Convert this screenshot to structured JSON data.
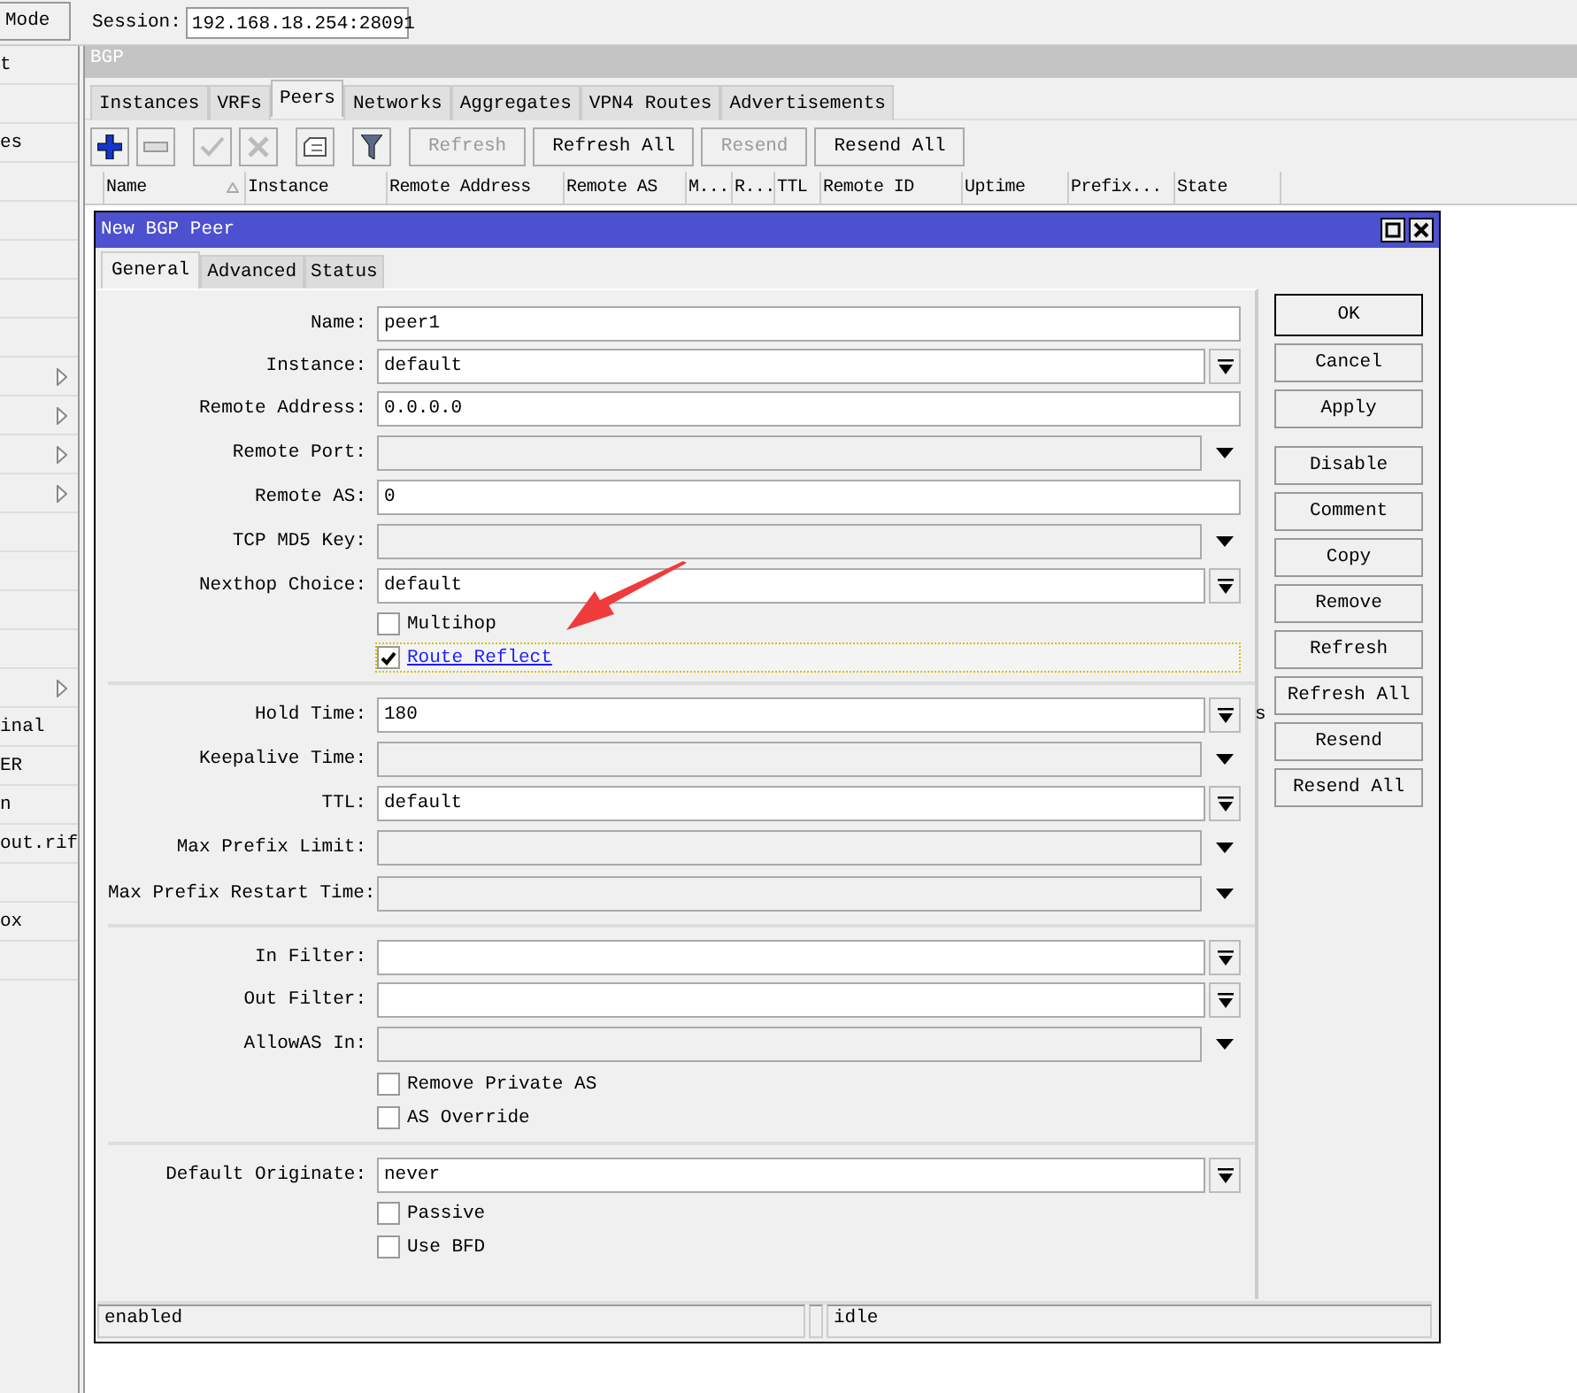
{
  "top_bar": {
    "mode_button": "Mode",
    "session_label": "Session:",
    "session_value": "192.168.18.254:28091"
  },
  "sidebar": {
    "items": [
      {
        "label": "t",
        "submenu": false
      },
      {
        "submenu": false
      },
      {
        "label": "es",
        "submenu": false
      },
      {
        "submenu": false
      },
      {
        "submenu": false
      },
      {
        "submenu": false
      },
      {
        "submenu": false
      },
      {
        "submenu": false
      },
      {
        "submenu": true
      },
      {
        "submenu": true
      },
      {
        "submenu": true
      },
      {
        "submenu": true
      },
      {
        "submenu": false
      },
      {
        "submenu": false
      },
      {
        "submenu": false
      },
      {
        "submenu": false
      },
      {
        "submenu": true
      },
      {
        "label": "inal",
        "submenu": false
      },
      {
        "label": "ER",
        "submenu": false
      },
      {
        "label": "n",
        "submenu": false
      },
      {
        "label": "out.rif",
        "submenu": false
      },
      {
        "submenu": false
      },
      {
        "label": "ox",
        "submenu": false
      },
      {
        "submenu": false
      }
    ]
  },
  "bgp_window": {
    "title": "BGP",
    "tabs": [
      {
        "label": "Instances",
        "selected": false
      },
      {
        "label": "VRFs",
        "selected": false
      },
      {
        "label": "Peers",
        "selected": true
      },
      {
        "label": "Networks",
        "selected": false
      },
      {
        "label": "Aggregates",
        "selected": false
      },
      {
        "label": "VPN4 Routes",
        "selected": false
      },
      {
        "label": "Advertisements",
        "selected": false
      }
    ],
    "toolbar": {
      "icon_buttons": [
        {
          "disabled": false
        },
        {
          "disabled": false
        },
        {
          "disabled": true
        },
        {
          "disabled": true
        },
        {
          "disabled": false
        },
        {
          "disabled": false
        }
      ],
      "text_buttons": [
        {
          "label": "Refresh",
          "disabled": true
        },
        {
          "label": "Refresh All",
          "disabled": false
        },
        {
          "label": "Resend",
          "disabled": true
        },
        {
          "label": "Resend All",
          "disabled": false
        }
      ]
    },
    "table": {
      "columns": [
        {
          "label": "Name",
          "sorted": true
        },
        {
          "label": "Instance",
          "sorted": false
        },
        {
          "label": "Remote Address",
          "sorted": false
        },
        {
          "label": "Remote AS",
          "sorted": false
        },
        {
          "label": "M...",
          "sorted": false
        },
        {
          "label": "R...",
          "sorted": false
        },
        {
          "label": "TTL",
          "sorted": false
        },
        {
          "label": "Remote ID",
          "sorted": false
        },
        {
          "label": "Uptime",
          "sorted": false
        },
        {
          "label": "Prefix...",
          "sorted": false
        },
        {
          "label": "State",
          "sorted": false
        }
      ]
    }
  },
  "dialog": {
    "title": "New BGP Peer",
    "tabs": [
      {
        "label": "General",
        "selected": true
      },
      {
        "label": "Advanced",
        "selected": false
      },
      {
        "label": "Status",
        "selected": false
      }
    ],
    "groups": [
      [
        {
          "kind": "text",
          "label": "Name:",
          "value": "peer1"
        },
        {
          "kind": "combo",
          "label": "Instance:",
          "value": "default"
        },
        {
          "kind": "text",
          "label": "Remote Address:",
          "value": "0.0.0.0"
        },
        {
          "kind": "select",
          "label": "Remote Port:"
        },
        {
          "kind": "text",
          "label": "Remote AS:",
          "value": "0"
        },
        {
          "kind": "select",
          "label": "TCP MD5 Key:"
        },
        {
          "kind": "combo",
          "label": "Nexthop Choice:",
          "value": "default"
        },
        {
          "kind": "checkbox",
          "label": "Multihop",
          "checked": false,
          "focused": false
        },
        {
          "kind": "checkbox",
          "label": "Route Reflect",
          "checked": true,
          "focused": true
        }
      ],
      [
        {
          "kind": "combo",
          "label": "Hold Time:",
          "value": "180",
          "unit": "s"
        },
        {
          "kind": "select",
          "label": "Keepalive Time:"
        },
        {
          "kind": "combo",
          "label": "TTL:",
          "value": "default"
        },
        {
          "kind": "select",
          "label": "Max Prefix Limit:"
        },
        {
          "kind": "select",
          "label": "Max Prefix Restart Time:"
        }
      ],
      [
        {
          "kind": "combo",
          "label": "In Filter:"
        },
        {
          "kind": "combo",
          "label": "Out Filter:"
        },
        {
          "kind": "select",
          "label": "AllowAS In:"
        },
        {
          "kind": "checkbox",
          "label": "Remove Private AS",
          "checked": false,
          "focused": false
        },
        {
          "kind": "checkbox",
          "label": "AS Override",
          "checked": false,
          "focused": false
        }
      ],
      [
        {
          "kind": "combo",
          "label": "Default Originate:",
          "value": "never"
        },
        {
          "kind": "checkbox",
          "label": "Passive",
          "checked": false,
          "focused": false
        },
        {
          "kind": "checkbox",
          "label": "Use BFD",
          "checked": false,
          "focused": false
        }
      ]
    ],
    "button_groups": [
      [
        {
          "label": "OK",
          "default": true
        },
        {
          "label": "Cancel",
          "default": false
        },
        {
          "label": "Apply",
          "default": false
        }
      ],
      [
        {
          "label": "Disable",
          "default": false
        },
        {
          "label": "Comment",
          "default": false
        },
        {
          "label": "Copy",
          "default": false
        },
        {
          "label": "Remove",
          "default": false
        },
        {
          "label": "Refresh",
          "default": false
        },
        {
          "label": "Refresh All",
          "default": false
        },
        {
          "label": "Resend",
          "default": false
        },
        {
          "label": "Resend All",
          "default": false
        }
      ]
    ],
    "status_bar": [
      "enabled",
      "idle"
    ]
  }
}
